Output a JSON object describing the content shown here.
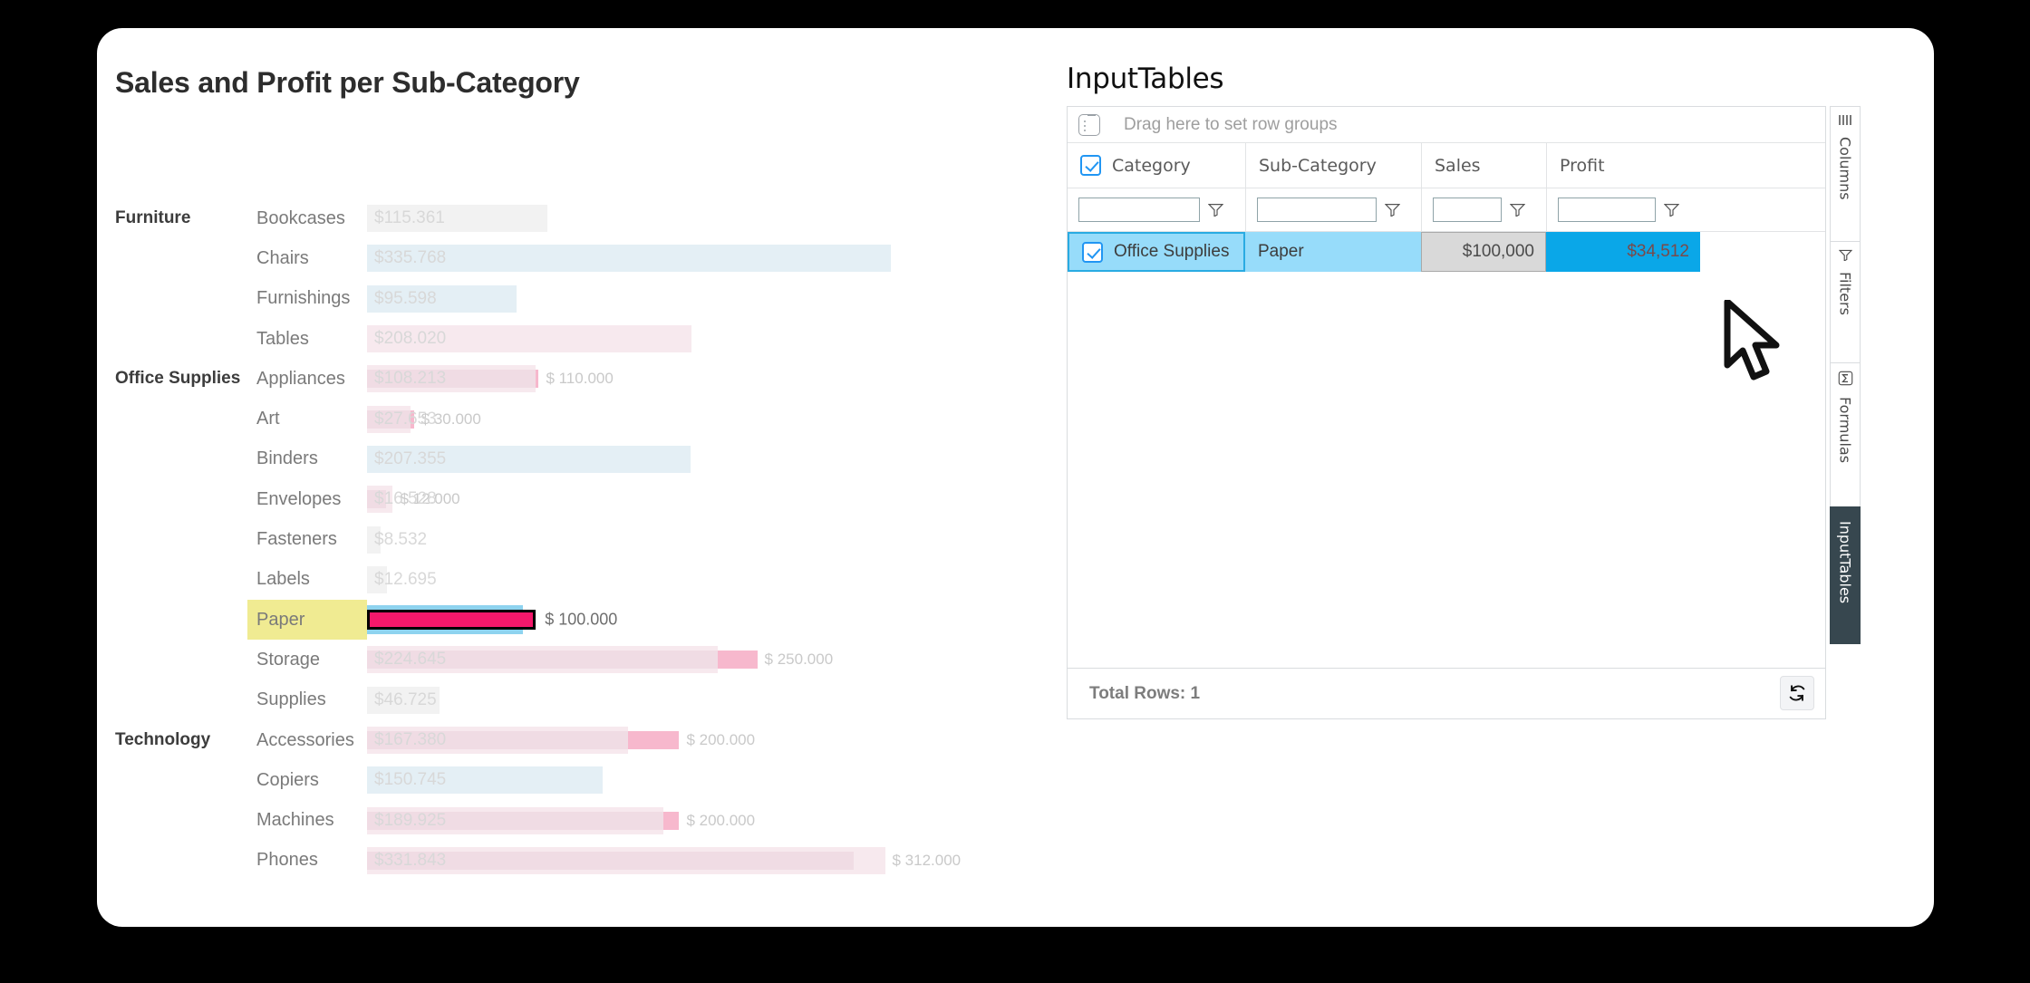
{
  "chart_data": {
    "type": "bar",
    "title": "Sales and Profit per Sub-Category",
    "xlabel": "",
    "ylabel": "",
    "grid": false,
    "legend": null,
    "series": [
      {
        "name": "Sales",
        "unit": "$"
      },
      {
        "name": "Profit",
        "unit": "$"
      }
    ],
    "axis_max": 360000,
    "categories": [
      "Furniture",
      "Office Supplies",
      "Technology"
    ],
    "rows": [
      {
        "category": "Furniture",
        "show_category": true,
        "sub_category": "Bookcases",
        "sales_label": "$115.361",
        "sales": 115361,
        "profit_tone": "neutral",
        "target_label": "",
        "target": null
      },
      {
        "category": "Furniture",
        "show_category": false,
        "sub_category": "Chairs",
        "sales_label": "$335.768",
        "sales": 335768,
        "profit_tone": "positive",
        "target_label": "",
        "target": null
      },
      {
        "category": "Furniture",
        "show_category": false,
        "sub_category": "Furnishings",
        "sales_label": "$95.598",
        "sales": 95598,
        "profit_tone": "positive",
        "target_label": "",
        "target": null
      },
      {
        "category": "Furniture",
        "show_category": false,
        "sub_category": "Tables",
        "sales_label": "$208.020",
        "sales": 208020,
        "profit_tone": "negative",
        "target_label": "",
        "target": null
      },
      {
        "category": "Office Supplies",
        "show_category": true,
        "sub_category": "Appliances",
        "sales_label": "$108.213",
        "sales": 108213,
        "profit_tone": "negative",
        "target_label": "$ 110.000",
        "target": 110000
      },
      {
        "category": "Office Supplies",
        "show_category": false,
        "sub_category": "Art",
        "sales_label": "$27.653",
        "sales": 27653,
        "profit_tone": "negative",
        "target_label": "$ 30.000",
        "target": 30000
      },
      {
        "category": "Office Supplies",
        "show_category": false,
        "sub_category": "Binders",
        "sales_label": "$207.355",
        "sales": 207355,
        "profit_tone": "positive",
        "target_label": "",
        "target": null
      },
      {
        "category": "Office Supplies",
        "show_category": false,
        "sub_category": "Envelopes",
        "sales_label": "$16.528",
        "sales": 16528,
        "profit_tone": "negative",
        "target_label": "$ 12.000",
        "target": 12000
      },
      {
        "category": "Office Supplies",
        "show_category": false,
        "sub_category": "Fasteners",
        "sales_label": "$8.532",
        "sales": 8532,
        "profit_tone": "neutral",
        "target_label": "",
        "target": null
      },
      {
        "category": "Office Supplies",
        "show_category": false,
        "sub_category": "Labels",
        "sales_label": "$12.695",
        "sales": 12695,
        "profit_tone": "neutral",
        "target_label": "",
        "target": null
      },
      {
        "category": "Office Supplies",
        "show_category": false,
        "sub_category": "Paper",
        "sales_label": "",
        "sales": 100000,
        "profit_tone": "selected",
        "target_label": "$ 100.000",
        "target": 100000,
        "highlight": true
      },
      {
        "category": "Office Supplies",
        "show_category": false,
        "sub_category": "Storage",
        "sales_label": "$224.645",
        "sales": 224645,
        "profit_tone": "negative",
        "target_label": "$ 250.000",
        "target": 250000
      },
      {
        "category": "Office Supplies",
        "show_category": false,
        "sub_category": "Supplies",
        "sales_label": "$46.725",
        "sales": 46725,
        "profit_tone": "neutral",
        "target_label": "",
        "target": null
      },
      {
        "category": "Technology",
        "show_category": true,
        "sub_category": "Accessories",
        "sales_label": "$167.380",
        "sales": 167380,
        "profit_tone": "negative",
        "target_label": "$ 200.000",
        "target": 200000
      },
      {
        "category": "Technology",
        "show_category": false,
        "sub_category": "Copiers",
        "sales_label": "$150.745",
        "sales": 150745,
        "profit_tone": "positive",
        "target_label": "",
        "target": null
      },
      {
        "category": "Technology",
        "show_category": false,
        "sub_category": "Machines",
        "sales_label": "$189.925",
        "sales": 189925,
        "profit_tone": "negative",
        "target_label": "$ 200.000",
        "target": 200000
      },
      {
        "category": "Technology",
        "show_category": false,
        "sub_category": "Phones",
        "sales_label": "$331.843",
        "sales": 331843,
        "profit_tone": "negative",
        "target_label": "$ 312.000",
        "target": 312000
      }
    ]
  },
  "grid_panel": {
    "title": "InputTables",
    "row_group_placeholder": "Drag here to set row groups",
    "row_group_icon": "row-group-icon",
    "columns": [
      {
        "label": "Category",
        "filter_value": "",
        "filter_icon": "funnel-icon"
      },
      {
        "label": "Sub-Category",
        "filter_value": "",
        "filter_icon": "funnel-icon"
      },
      {
        "label": "Sales",
        "filter_value": "",
        "filter_icon": "funnel-icon"
      },
      {
        "label": "Profit",
        "filter_value": "",
        "filter_icon": "funnel-icon"
      }
    ],
    "header_select_all_checked": true,
    "rows": [
      {
        "checked": true,
        "category": "Office Supplies",
        "sub_category": "Paper",
        "sales": "$100,000",
        "profit": "$34,512"
      }
    ],
    "footer": {
      "total_rows_label": "Total Rows: 1",
      "refresh_icon": "refresh-icon"
    },
    "tool_tabs": [
      {
        "label": "Columns",
        "icon": "columns-icon",
        "active": false
      },
      {
        "label": "Filters",
        "icon": "funnel-icon",
        "active": false
      },
      {
        "label": "Formulas",
        "icon": "sigma-icon",
        "active": false
      },
      {
        "label": "InputTables",
        "icon": "none",
        "active": true
      }
    ]
  },
  "colors": {
    "accent_blue": "#29ABE2",
    "row_selected": "#97DCFA",
    "cell_editing": "#D9D9D9",
    "highlight_yellow": "#F0EB92",
    "selected_bar": "#F4186B",
    "sales_bar_selected": "#8ED3EF",
    "bar_positive": "#E4EFF5",
    "bar_negative": "#F7E9EE",
    "bar_neutral": "#F2F2F2",
    "tab_active_bg": "#37474F",
    "page_background": "#000000"
  },
  "cursor": {
    "icon": "arrow-cursor"
  }
}
